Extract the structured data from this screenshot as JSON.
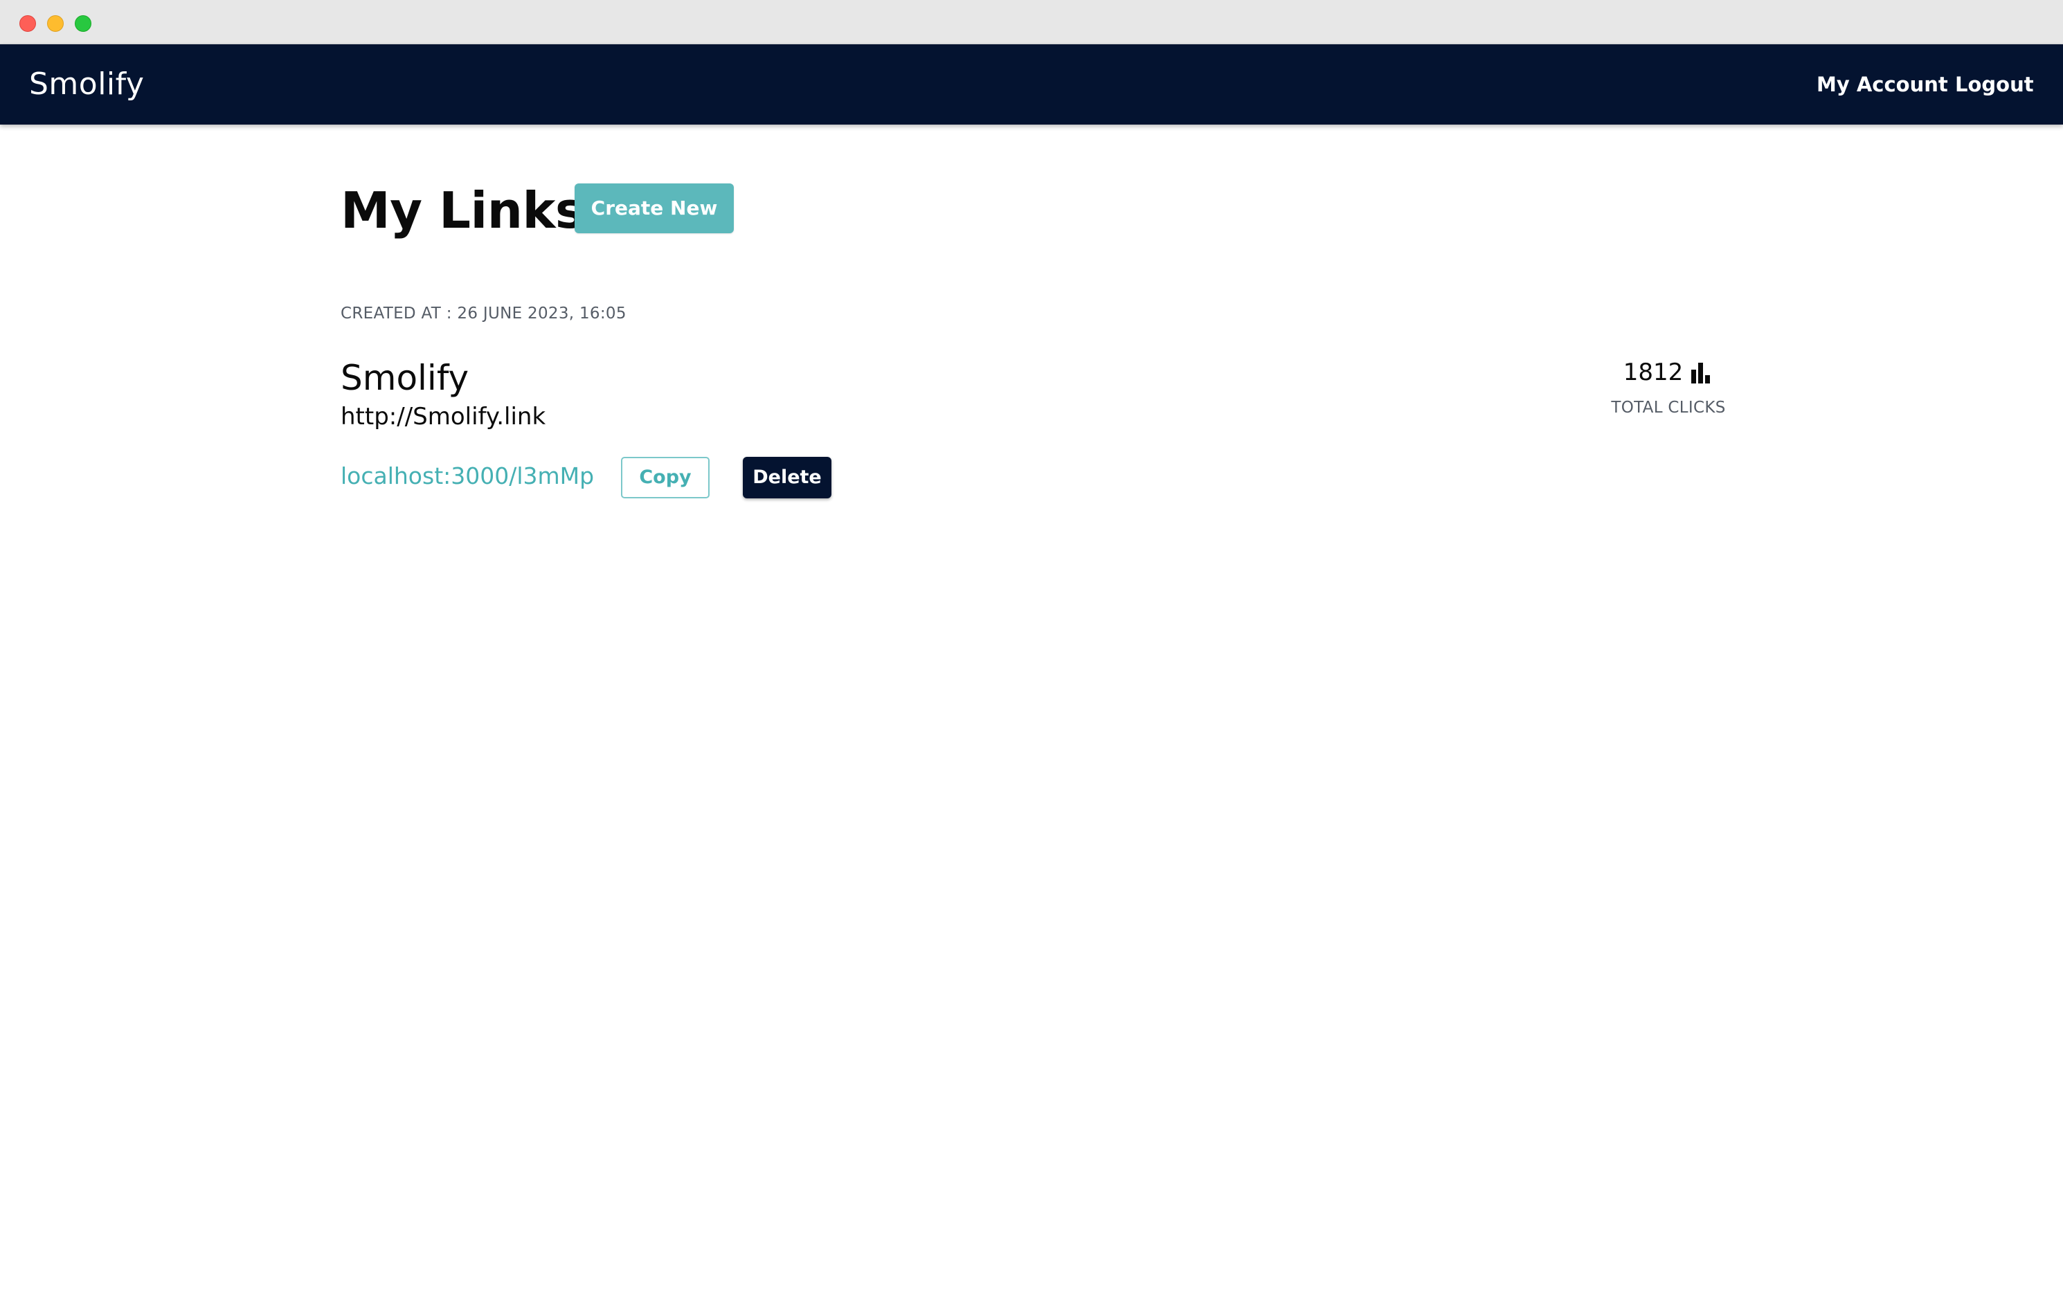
{
  "app": {
    "brand": "Smolify",
    "nav": {
      "account": "My Account",
      "logout": "Logout"
    }
  },
  "main": {
    "title": "My Links",
    "create_button": "Create New"
  },
  "link_card": {
    "created_at": "CREATED AT : 26 JUNE 2023, 16:05",
    "title": "Smolify",
    "original_url": "http://Smolify.link",
    "short_url": "localhost:3000/l3mMp",
    "copy_button": "Copy",
    "delete_button": "Delete",
    "clicks": "1812",
    "clicks_label": "TOTAL CLICKS",
    "clicks_icon": "bar-chart-icon"
  },
  "colors": {
    "nav_bg": "#041330",
    "accent": "#5cb8bb",
    "link_teal": "#45b0b3",
    "delete_bg": "#041330"
  }
}
